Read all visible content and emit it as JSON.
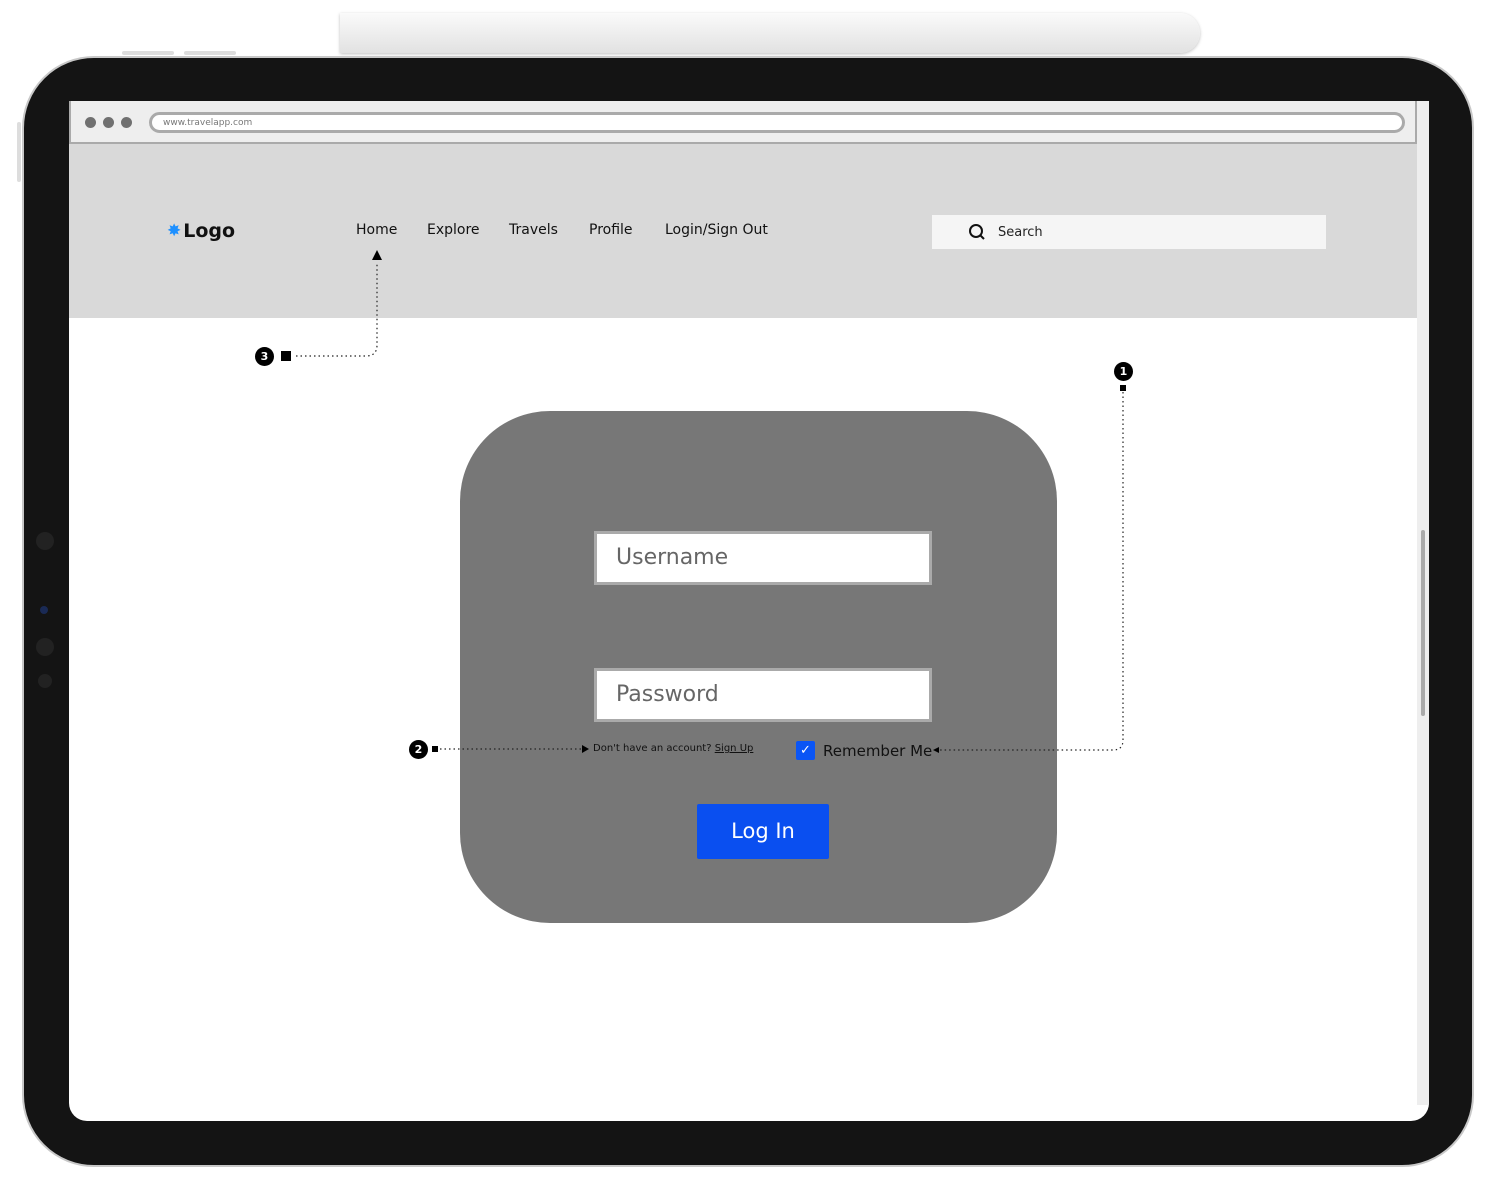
{
  "browser": {
    "url": "www.travelapp.com"
  },
  "nav": {
    "logo": "Logo",
    "logo_color": "#1e90ff",
    "links": [
      "Home",
      "Explore",
      "Travels",
      "Profile",
      "Login/Sign Out"
    ],
    "search_placeholder": "Search"
  },
  "login": {
    "username_placeholder": "Username",
    "password_placeholder": "Password",
    "signup_prompt": "Don't have an account?",
    "signup_link": "Sign Up",
    "remember_label": "Remember Me",
    "remember_checked": true,
    "login_button": "Log In",
    "button_color": "#0a4ff0"
  },
  "annotations": [
    "1",
    "2",
    "3"
  ]
}
